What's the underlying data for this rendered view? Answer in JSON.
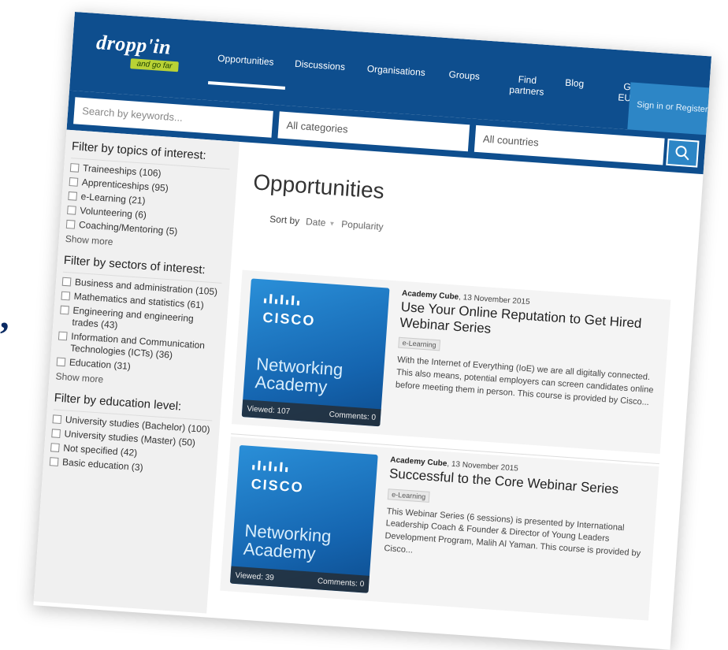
{
  "quote_mark": ",",
  "header": {
    "logo_text": "dropp'in",
    "logo_tagline": "and go far",
    "nav": [
      "Opportunities",
      "Discussions",
      "Organisations",
      "Groups",
      "Find partners",
      "Blog",
      "Go to EURES"
    ],
    "signin": "Sign in or Register"
  },
  "search": {
    "placeholder": "Search by keywords...",
    "category": "All categories",
    "country": "All countries",
    "button_icon": "search-icon"
  },
  "sidebar": {
    "topics_title": "Filter by topics of interest:",
    "topics": [
      "Traineeships (106)",
      "Apprenticeships (95)",
      "e-Learning (21)",
      "Volunteering (6)",
      "Coaching/Mentoring (5)"
    ],
    "sectors_title": "Filter by sectors of interest:",
    "sectors": [
      "Business and administration (105)",
      "Mathematics and statistics (61)",
      "Engineering and engineering trades (43)",
      "Information and Communication Technologies (ICTs) (36)",
      "Education (31)"
    ],
    "education_title": "Filter by education level:",
    "education": [
      "University studies (Bachelor) (100)",
      "University studies (Master) (50)",
      "Not specified (42)",
      "Basic education (3)"
    ],
    "show_more": "Show more"
  },
  "main": {
    "title": "Opportunities",
    "sort_label": "Sort by",
    "sort_date": "Date",
    "sort_popularity": "Popularity",
    "thumb_brand": "CISCO",
    "thumb_line1": "Networking",
    "thumb_line2": "Academy",
    "cards": [
      {
        "author": "Academy Cube",
        "date": ", 13 November 2015",
        "title": "Use Your Online Reputation to Get Hired Webinar Series",
        "tag": "e-Learning",
        "excerpt": "With the Internet of Everything (IoE) we are all digitally connected. This also means, potential employers can screen candidates online before meeting them in person. This course is provided by Cisco...",
        "viewed": "Viewed: 107",
        "comments": "Comments: 0"
      },
      {
        "author": "Academy Cube",
        "date": ", 13 November 2015",
        "title": "Successful to the Core Webinar Series",
        "tag": "e-Learning",
        "excerpt": "This Webinar Series (6 sessions) is presented by International Leadership Coach & Founder & Director of Young Leaders Development Program, Malih Al Yaman. This course is provided by Cisco...",
        "viewed": "Viewed: 39",
        "comments": "Comments: 0"
      }
    ]
  },
  "colors": {
    "header_bg": "#0e4e8e",
    "signin_bg": "#2d86c6",
    "logo_tag_bg": "#b9d235",
    "thumb_gradient_top": "#2a8fd8",
    "thumb_gradient_bottom": "#0d4d8f"
  }
}
